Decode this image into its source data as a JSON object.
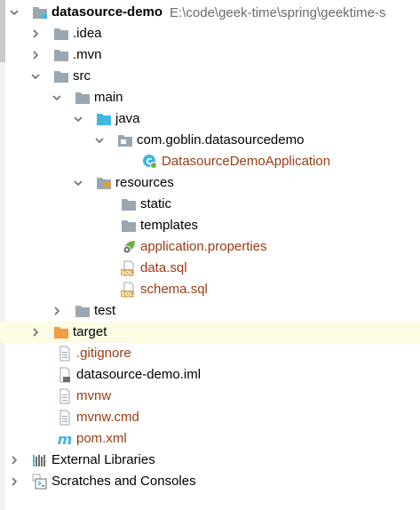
{
  "window": {
    "title": "Project tree"
  },
  "colors": {
    "folder_gray": "#9aa7b0",
    "folder_blue": "#40b6e0",
    "folder_orange": "#f09d43",
    "vcs_new": "#9b3b14",
    "selected_row": "#fcfbe3"
  },
  "tree": {
    "root": {
      "name": "datasource-demo",
      "path": "E:\\code\\geek-time\\spring\\geektime-s",
      "icon": "module-folder-icon"
    },
    "idea": {
      "name": ".idea",
      "icon": "folder-icon"
    },
    "mvn": {
      "name": ".mvn",
      "icon": "folder-icon"
    },
    "src": {
      "name": "src",
      "icon": "folder-icon"
    },
    "main": {
      "name": "main",
      "icon": "folder-icon"
    },
    "java": {
      "name": "java",
      "icon": "source-folder-icon"
    },
    "package": {
      "name": "com.goblin.datasourcedemo",
      "icon": "package-icon"
    },
    "app_class": {
      "name": "DatasourceDemoApplication",
      "icon": "spring-boot-class-icon"
    },
    "resources": {
      "name": "resources",
      "icon": "resources-folder-icon"
    },
    "static": {
      "name": "static",
      "icon": "folder-icon"
    },
    "templates": {
      "name": "templates",
      "icon": "folder-icon"
    },
    "app_props": {
      "name": "application.properties",
      "icon": "spring-properties-icon"
    },
    "data_sql": {
      "name": "data.sql",
      "icon": "sql-file-icon"
    },
    "schema_sql": {
      "name": "schema.sql",
      "icon": "sql-file-icon"
    },
    "test": {
      "name": "test",
      "icon": "folder-icon"
    },
    "target": {
      "name": "target",
      "icon": "excluded-folder-icon"
    },
    "gitignore": {
      "name": ".gitignore",
      "icon": "text-file-icon"
    },
    "iml": {
      "name": "datasource-demo.iml",
      "icon": "iml-file-icon"
    },
    "mvnw": {
      "name": "mvnw",
      "icon": "text-file-icon"
    },
    "mvnw_cmd": {
      "name": "mvnw.cmd",
      "icon": "text-file-icon"
    },
    "pom": {
      "name": "pom.xml",
      "icon": "maven-icon"
    },
    "ext_libs": {
      "name": "External Libraries",
      "icon": "libraries-icon"
    },
    "scratches": {
      "name": "Scratches and Consoles",
      "icon": "scratches-icon"
    }
  }
}
